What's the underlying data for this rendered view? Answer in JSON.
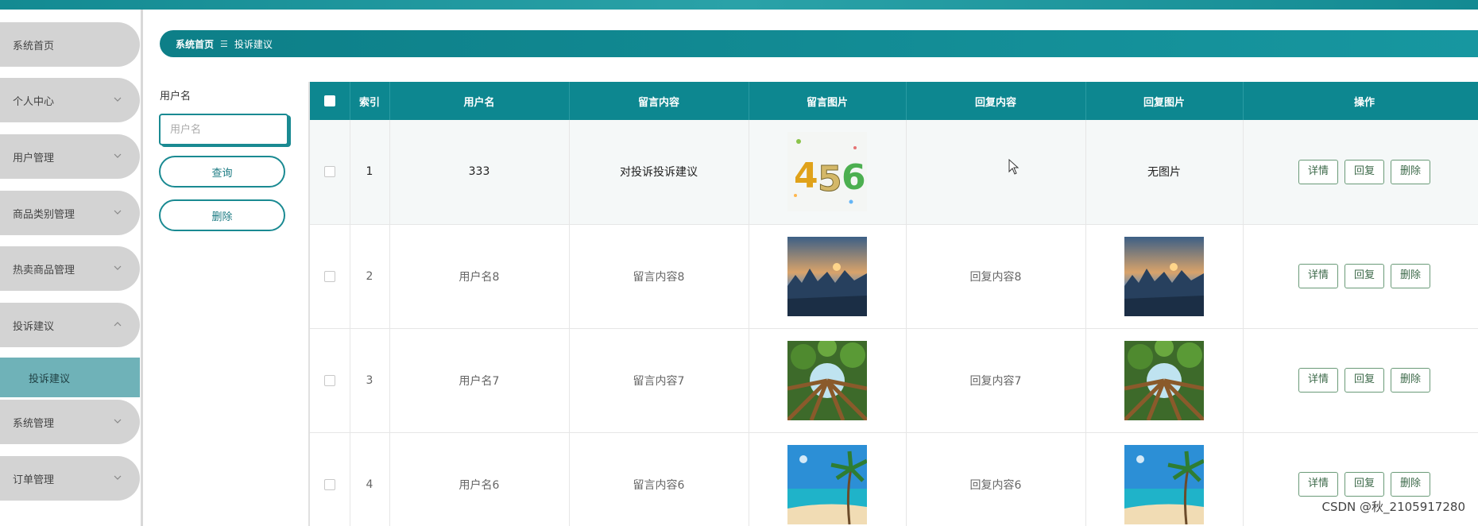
{
  "sidebar": {
    "items": [
      {
        "label": "系统首页",
        "has_chevron": false
      },
      {
        "label": "个人中心",
        "has_chevron": true
      },
      {
        "label": "用户管理",
        "has_chevron": true
      },
      {
        "label": "商品类别管理",
        "has_chevron": true
      },
      {
        "label": "热卖商品管理",
        "has_chevron": true
      },
      {
        "label": "投诉建议",
        "has_chevron": true,
        "expanded": true
      },
      {
        "label": "系统管理",
        "has_chevron": true
      },
      {
        "label": "订单管理",
        "has_chevron": true
      }
    ],
    "subitem": {
      "label": "投诉建议"
    }
  },
  "breadcrumb": {
    "home": "系统首页",
    "separator": "☰",
    "current": "投诉建议"
  },
  "search": {
    "label": "用户名",
    "placeholder": "用户名",
    "query_button": "查询",
    "delete_button": "删除"
  },
  "table": {
    "headers": [
      "",
      "索引",
      "用户名",
      "留言内容",
      "留言图片",
      "回复内容",
      "回复图片",
      "操作"
    ],
    "rows": [
      {
        "index": "1",
        "username": "333",
        "message": "对投诉投诉建议",
        "message_image": "number-456",
        "reply": "",
        "reply_image": "无图片"
      },
      {
        "index": "2",
        "username": "用户名8",
        "message": "留言内容8",
        "message_image": "mountain-sunset",
        "reply": "回复内容8",
        "reply_image": "mountain-sunset"
      },
      {
        "index": "3",
        "username": "用户名7",
        "message": "留言内容7",
        "message_image": "forest-canopy",
        "reply": "回复内容7",
        "reply_image": "forest-canopy"
      },
      {
        "index": "4",
        "username": "用户名6",
        "message": "留言内容6",
        "message_image": "beach-palm",
        "reply": "回复内容6",
        "reply_image": "beach-palm"
      }
    ],
    "actions": {
      "detail": "详情",
      "reply": "回复",
      "delete": "删除"
    }
  },
  "watermark": "CSDN @秋_2105917280",
  "colors": {
    "accent": "#0d8790",
    "sidebar_bg": "#d3d3d3",
    "submenu_active": "#6fb2b8"
  }
}
